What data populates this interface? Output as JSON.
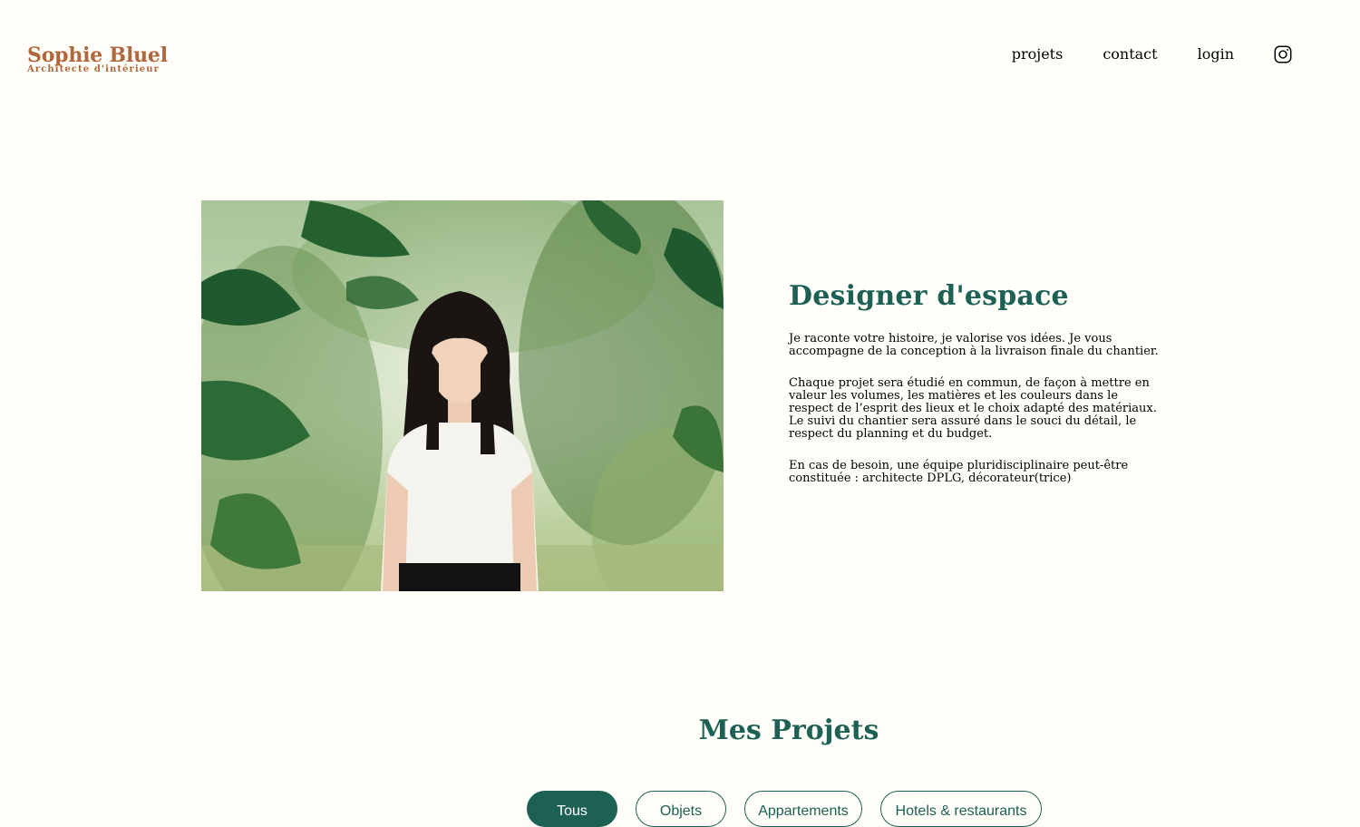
{
  "header": {
    "logo_title": "Sophie Bluel",
    "logo_subtitle": "Architecte d'intérieur",
    "nav": [
      "projets",
      "contact",
      "login"
    ],
    "social_icon": "instagram-icon"
  },
  "intro": {
    "image_icon": "portrait-photo",
    "title": "Designer d'espace",
    "paragraphs": [
      "Je raconte votre histoire, je valorise vos idées. Je vous accompagne de la conception à la livraison finale du chantier.",
      "Chaque projet sera étudié en commun, de façon à mettre en valeur les volumes, les matières et les couleurs dans le respect de l’esprit des lieux et le choix adapté des matériaux. Le suivi du chantier sera assuré dans le souci du détail, le respect du planning et du budget.",
      "En cas de besoin, une équipe pluridisciplinaire peut-être constituée : architecte DPLG, décorateur(trice)"
    ]
  },
  "projects": {
    "title": "Mes Projets",
    "filters": [
      "Tous",
      "Objets",
      "Appartements",
      "Hotels & restaurants"
    ],
    "active_filter": "Tous"
  },
  "colors": {
    "background": "#FFFEF8",
    "brand_orange": "#B1663C",
    "brand_green": "#1D6154"
  }
}
